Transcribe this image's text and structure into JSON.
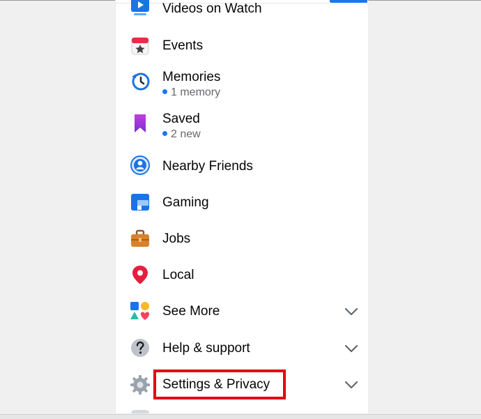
{
  "menu": {
    "items": [
      {
        "key": "watch",
        "label": "Videos on Watch",
        "icon": "watch-video-icon"
      },
      {
        "key": "events",
        "label": "Events",
        "icon": "calendar-star-icon"
      },
      {
        "key": "memories",
        "label": "Memories",
        "icon": "clock-history-icon",
        "sub": "1 memory"
      },
      {
        "key": "saved",
        "label": "Saved",
        "icon": "bookmark-icon",
        "sub": "2 new"
      },
      {
        "key": "nearby",
        "label": "Nearby Friends",
        "icon": "nearby-friends-icon"
      },
      {
        "key": "gaming",
        "label": "Gaming",
        "icon": "gaming-icon"
      },
      {
        "key": "jobs",
        "label": "Jobs",
        "icon": "briefcase-icon"
      },
      {
        "key": "local",
        "label": "Local",
        "icon": "map-pin-icon"
      },
      {
        "key": "seemore",
        "label": "See More",
        "icon": "shapes-icon",
        "expandable": true
      },
      {
        "key": "help",
        "label": "Help & support",
        "icon": "question-icon",
        "expandable": true
      },
      {
        "key": "settings",
        "label": "Settings & Privacy",
        "icon": "gear-icon",
        "expandable": true,
        "highlighted": true
      }
    ]
  },
  "colors": {
    "accent": "#1877f2",
    "highlight_box": "#e60012",
    "text_primary": "#050505",
    "text_secondary": "#65676b"
  }
}
